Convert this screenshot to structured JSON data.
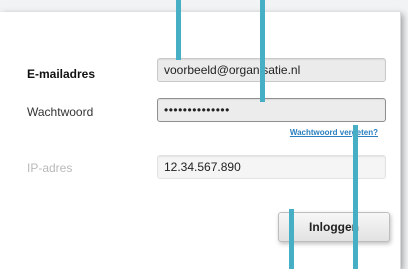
{
  "form": {
    "email_label": "E-mailadres",
    "email_value": "voorbeeld@organisatie.nl",
    "password_label": "Wachtwoord",
    "password_value": "••••••••••••••",
    "forgot_label": "Wachtwoord vergeten?",
    "ip_label": "IP-adres",
    "ip_value": "12.34.567.890",
    "login_label": "Inloggen"
  },
  "colors": {
    "callout": "#46afc6",
    "link": "#2a7fbf",
    "ip_label": "#b9b9b9"
  }
}
